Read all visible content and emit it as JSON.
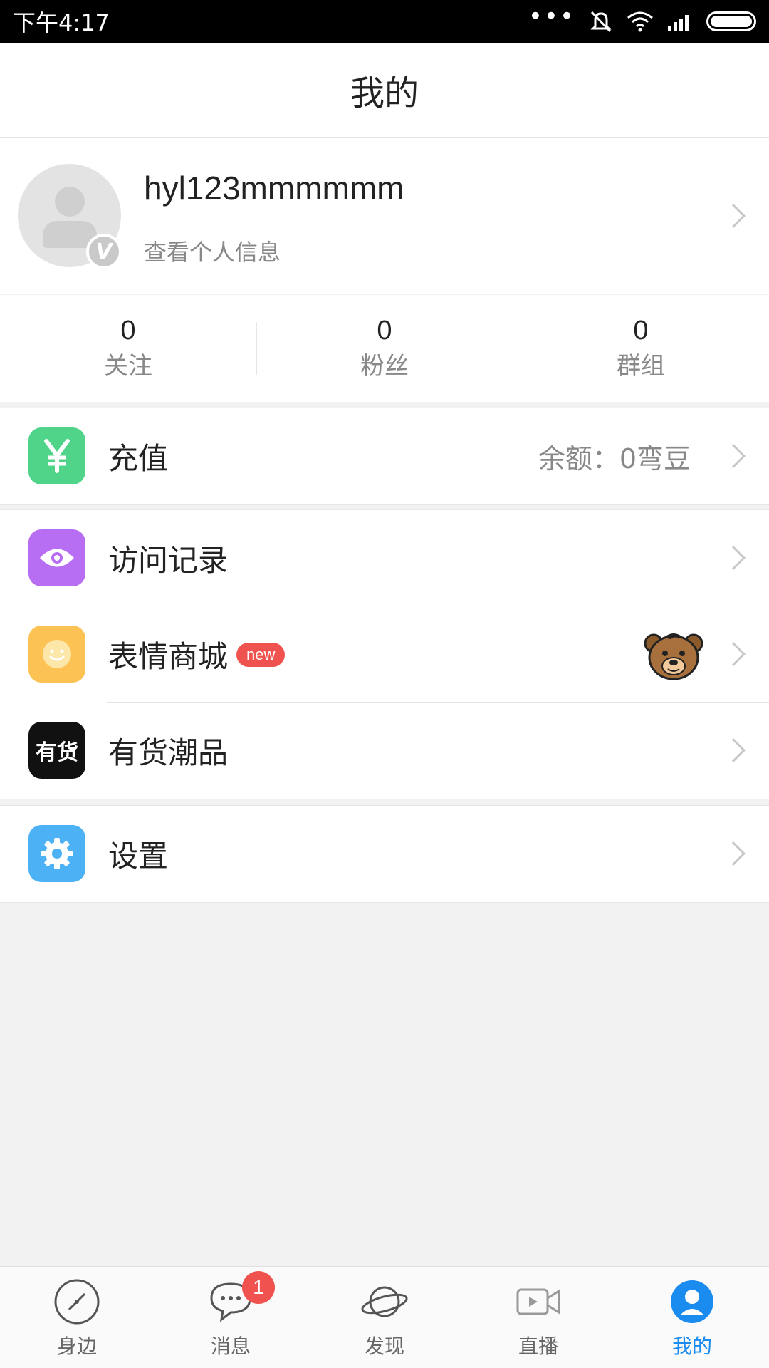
{
  "status_bar": {
    "time": "下午4:17",
    "icons": [
      "more-dots-icon",
      "mute-icon",
      "wifi-icon",
      "signal-icon",
      "battery-icon"
    ]
  },
  "header": {
    "title": "我的"
  },
  "profile": {
    "username": "hyl123mmmmmm",
    "subtitle": "查看个人信息",
    "badge": "V"
  },
  "stats": [
    {
      "value": "0",
      "label": "关注"
    },
    {
      "value": "0",
      "label": "粉丝"
    },
    {
      "value": "0",
      "label": "群组"
    }
  ],
  "menu": {
    "recharge": {
      "label": "充值",
      "value": "余额：0弯豆",
      "icon": "yen-icon",
      "color": "#4fd48a"
    },
    "visits": {
      "label": "访问记录",
      "icon": "eye-icon",
      "color": "#b86ef2"
    },
    "stickers": {
      "label": "表情商城",
      "badge": "new",
      "icon": "smile-icon",
      "color": "#fcc254"
    },
    "yoho": {
      "label": "有货潮品",
      "icon_text": "有货",
      "icon": "yoho-logo-icon",
      "color": "#111111"
    },
    "settings": {
      "label": "设置",
      "icon": "gear-icon",
      "color": "#4db2f5"
    }
  },
  "tabbar": {
    "tabs": [
      {
        "label": "身边",
        "icon": "compass-icon"
      },
      {
        "label": "消息",
        "icon": "chat-icon",
        "badge": "1"
      },
      {
        "label": "发现",
        "icon": "planet-icon"
      },
      {
        "label": "直播",
        "icon": "video-icon"
      },
      {
        "label": "我的",
        "icon": "profile-icon",
        "active": true
      }
    ]
  },
  "colors": {
    "accent": "#1a8cf0",
    "badge": "#f0524f"
  }
}
